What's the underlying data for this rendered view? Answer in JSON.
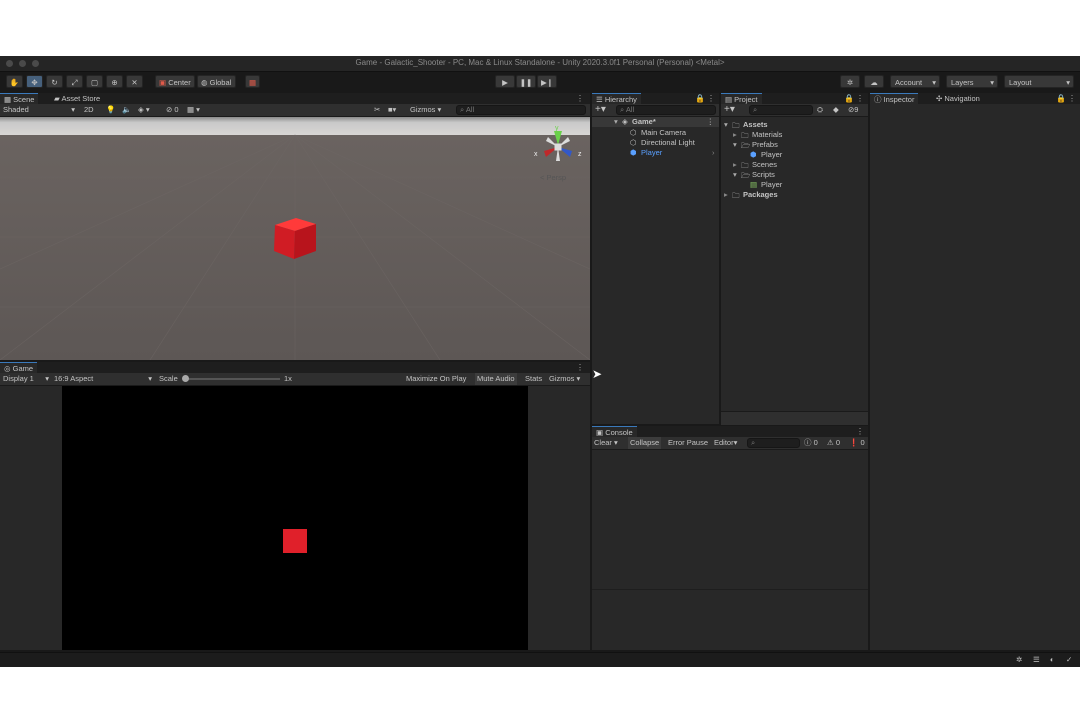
{
  "window": {
    "title": "Game - Galactic_Shooter - PC, Mac & Linux Standalone - Unity 2020.3.0f1 Personal (Personal) <Metal>"
  },
  "toolbar": {
    "pivot_label": "Center",
    "space_label": "Global",
    "account_label": "Account",
    "layers_label": "Layers",
    "layout_label": "Layout"
  },
  "scene": {
    "tabs": [
      "Scene",
      "Asset Store"
    ],
    "shading_mode": "Shaded",
    "mode_2d": "2D",
    "hidden_count": "0",
    "gizmos_label": "Gizmos",
    "search_placeholder": "All",
    "gizmo_axes": {
      "x": "x",
      "y": "y",
      "z": "z"
    },
    "persp_label": "Persp",
    "cube_color": "#e0202a"
  },
  "game": {
    "tab": "Game",
    "display": "Display 1",
    "aspect": "16:9 Aspect",
    "scale_label": "Scale",
    "scale_value": "1x",
    "maximize_label": "Maximize On Play",
    "mute_label": "Mute Audio",
    "stats_label": "Stats",
    "gizmos_label": "Gizmos"
  },
  "hierarchy": {
    "tab": "Hierarchy",
    "search_placeholder": "All",
    "scene_name": "Game*",
    "items": [
      "Main Camera",
      "Directional Light",
      "Player"
    ]
  },
  "project": {
    "tab": "Project",
    "hidden_count": "9",
    "assets_label": "Assets",
    "folders": {
      "materials": "Materials",
      "prefabs": "Prefabs",
      "prefab_player": "Player",
      "scenes": "Scenes",
      "scripts": "Scripts",
      "script_player": "Player",
      "packages": "Packages"
    }
  },
  "inspector": {
    "tab": "Inspector",
    "navigation_tab": "Navigation"
  },
  "console": {
    "tab": "Console",
    "clear_label": "Clear",
    "collapse_label": "Collapse",
    "error_pause_label": "Error Pause",
    "editor_label": "Editor",
    "log_count": "0",
    "warning_count": "0",
    "error_count": "0"
  },
  "colors": {
    "accent": "#3a79bb",
    "selection_text": "#5aa0ff",
    "cube": "#e0202a"
  }
}
